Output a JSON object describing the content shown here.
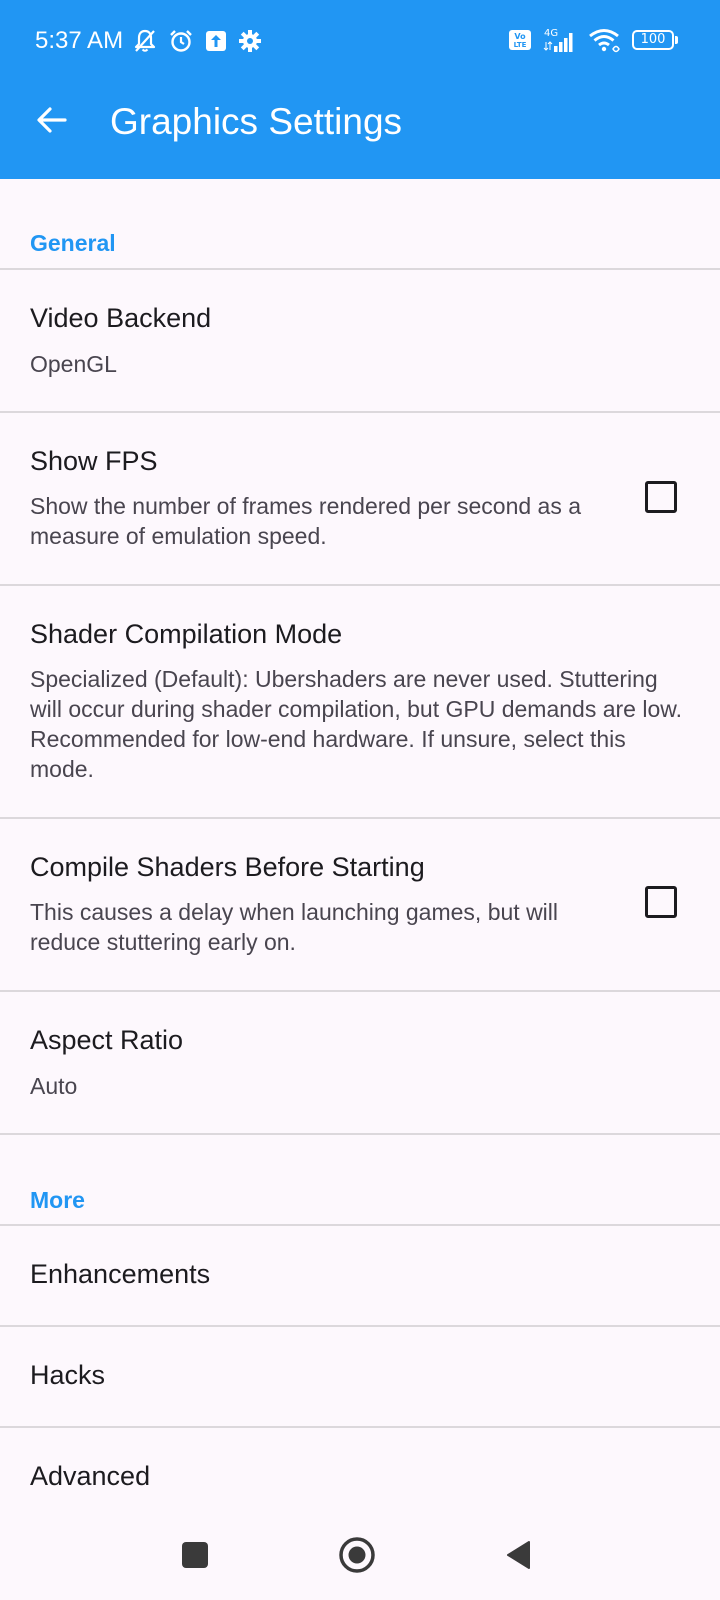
{
  "status_bar": {
    "time": "5:37 AM",
    "network": "4G",
    "volte": "Vo LTE",
    "battery": "100"
  },
  "app_bar": {
    "title": "Graphics Settings"
  },
  "colors": {
    "accent": "#2196f3",
    "background": "#fdf8fd"
  },
  "sections": {
    "general": {
      "header": "General",
      "items": [
        {
          "title": "Video Backend",
          "summary": "OpenGL"
        },
        {
          "title": "Show FPS",
          "summary": "Show the number of frames rendered per second as a measure of emulation speed.",
          "checked": false
        },
        {
          "title": "Shader Compilation Mode",
          "summary": "Specialized (Default): Ubershaders are never used. Stuttering will occur during shader compilation, but GPU demands are low. Recommended for low-end hardware. If unsure, select this mode."
        },
        {
          "title": "Compile Shaders Before Starting",
          "summary": "This causes a delay when launching games, but will reduce stuttering early on.",
          "checked": false
        },
        {
          "title": "Aspect Ratio",
          "summary": "Auto"
        }
      ]
    },
    "more": {
      "header": "More",
      "items": [
        {
          "title": "Enhancements"
        },
        {
          "title": "Hacks"
        },
        {
          "title": "Advanced"
        }
      ]
    }
  },
  "nav_bar": {
    "icons": [
      "recents-square-icon",
      "home-circle-icon",
      "back-triangle-icon"
    ]
  }
}
